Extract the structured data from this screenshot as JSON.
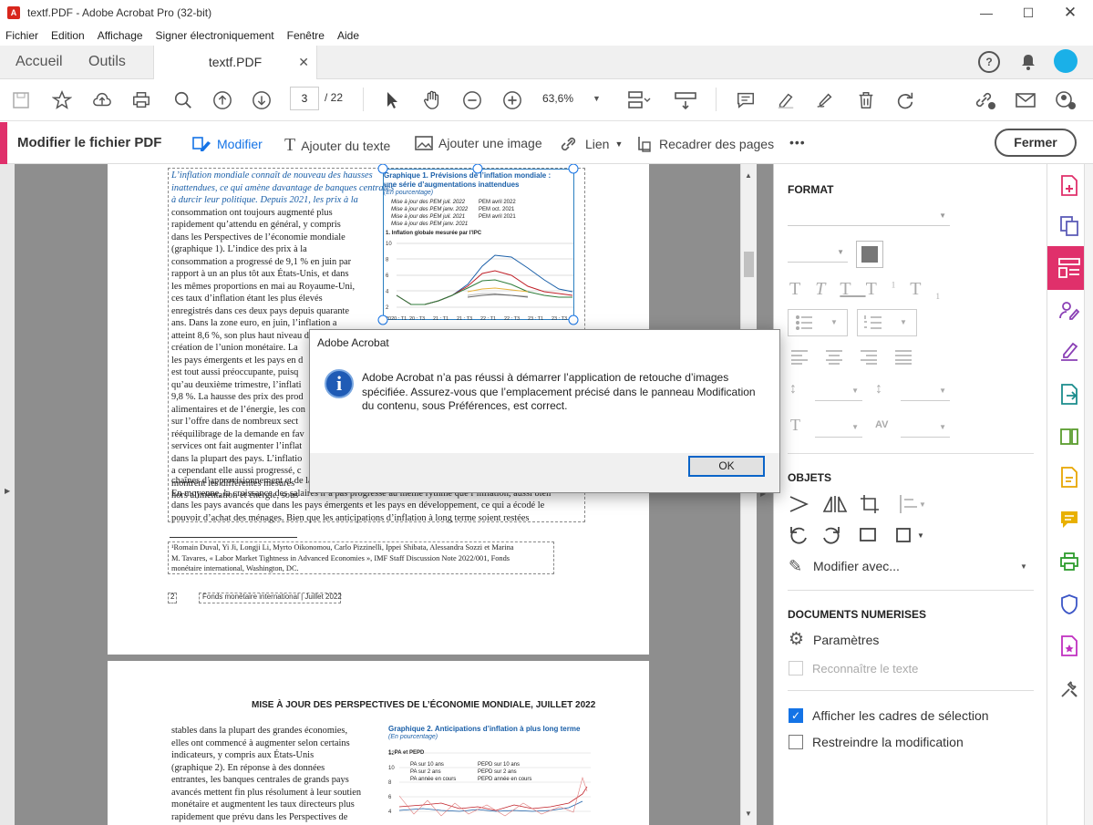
{
  "window": {
    "title": "textf.PDF - Adobe Acrobat Pro (32-bit)"
  },
  "menu": [
    "Fichier",
    "Edition",
    "Affichage",
    "Signer électroniquement",
    "Fenêtre",
    "Aide"
  ],
  "tabs": {
    "home": "Accueil",
    "tools": "Outils",
    "doc": "textf.PDF"
  },
  "toolbar": {
    "page_current": "3",
    "page_total": "/ 22",
    "zoom": "63,6%"
  },
  "editbar": {
    "title": "Modifier le fichier PDF",
    "items": [
      "Modifier",
      "Ajouter du texte",
      "Ajouter une image",
      "Lien",
      "Recadrer des pages"
    ],
    "more": "•••",
    "close": "Fermer"
  },
  "page1": {
    "col_lines": [
      "L’inflation mondiale connaît de nouveau des hausses",
      "inattendues, ce qui amène davantage de banques centrales",
      "à durcir leur politique. Depuis 2021, les prix à la",
      "consommation ont toujours augmenté plus",
      "rapidement qu’attendu en général, y compris",
      "dans les Perspectives de l’économie mondiale",
      "(graphique 1). L’indice des prix à la",
      "consommation a progressé de 9,1 % en juin par",
      "rapport à un an plus tôt aux États-Unis, et dans",
      "les mêmes proportions en mai au Royaume-Uni,",
      "ces taux d’inflation étant les plus élevés",
      "enregistrés dans ces deux pays depuis quarante",
      "ans. Dans la zone euro, en juin, l’inflation a",
      "atteint 8,6 %, son plus haut niveau depuis la",
      "création de l’union monétaire. La",
      "les pays émergents et les pays en d",
      "est tout aussi préoccupante, puisq",
      "qu’au deuxième trimestre, l’inflati",
      "9,8 %. La hausse des prix des prod",
      "alimentaires et de l’énergie, les con",
      "sur l’offre dans de nombreux sect",
      "rééquilibrage de la demande en fav",
      "services ont fait augmenter l’inflat",
      "dans la plupart des pays. L’inflatio",
      "a cependant elle aussi progressé, c",
      "montrent les différentes mesures",
      "hors alimentation et énergie, sous"
    ],
    "wide_lines": [
      "chaînes d’approvisionnement et de la pénurie de main-d’œuvre, en particulier dans les pays avancés¹.",
      "En moyenne, la croissance des salaires n’a pas progressé au même rythme que l’inflation, aussi bien",
      "dans les pays avancés que dans les pays émergents et les pays en développement, ce qui a écodé le",
      "pouvoir d’achat des ménages. Bien que les anticipations d’inflation à long terme soient restées"
    ],
    "footnote": [
      "¹Romain Duval, Yi Ji, Longji Li, Myrto Oikonomou, Carlo Pizzinelli, Ippei Shibata, Alessandra Sozzi et Marina",
      "M. Tavares, « Labor Market Tightness in Advanced Economies », IMF Staff Discussion Note 2022/001, Fonds",
      "monétaire international, Washington, DC."
    ],
    "page_num": "2",
    "page_footer": "Fonds monétaire international | Juillet 2022",
    "chart": {
      "title1": "Graphique 1.  Prévisions de l’inflation mondiale :",
      "title2": "une série d’augmentations inattendues",
      "unit": "(En pourcentage)",
      "legend_left": [
        "Mise à jour des PEM juil. 2022",
        "Mise à jour des PEM janv. 2022",
        "Mise à jour des PEM juil. 2021",
        "Mise à jour des PEM janv. 2021"
      ],
      "legend_right": [
        "PEM avril 2022",
        "PEM oct. 2021",
        "PEM avril 2021"
      ],
      "subtitle": "1.  Inflation globale mesurée par l’IPC",
      "yticks": [
        "10",
        "8",
        "6",
        "4",
        "2",
        "0"
      ],
      "xticks": [
        "2020 : T1",
        "20 : T3",
        "21 : T1",
        "21 : T3",
        "22 : T1",
        "22 : T3",
        "23 : T1",
        "23 : T3"
      ]
    }
  },
  "page2": {
    "header": "MISE À JOUR DES PERSPECTIVES DE L’ÉCONOMIE MONDIALE, JUILLET 2022",
    "lines": [
      "stables dans la plupart des grandes économies,",
      "elles ont commencé à augmenter selon certains",
      "indicateurs, y compris aux États-Unis",
      "(graphique 2). En réponse à des données",
      "entrantes, les banques centrales de grands pays",
      "avancés mettent fin plus résolument à leur soutien",
      "monétaire et augmentent les taux directeurs plus",
      "rapidement que prévu dans les Perspectives de"
    ],
    "chart": {
      "title": "Graphique 2.  Anticipations d’inflation à plus long terme",
      "unit": "(En pourcentage)",
      "subtitle": "1.  PA et PEPD",
      "yticks": [
        "12",
        "10",
        "8",
        "6",
        "4"
      ],
      "legend_left": [
        "PA sur 10 ans",
        "PA sur 2 ans",
        "PA année en cours"
      ],
      "legend_right": [
        "PEPD sur 10 ans",
        "PEPD sur 2 ans",
        "PEPD année en cours"
      ]
    }
  },
  "dialog": {
    "title": "Adobe Acrobat",
    "message": [
      "Adobe Acrobat n’a pas réussi à démarrer l’application de retouche d’images",
      "spécifiée. Assurez-vous que l’emplacement précisé dans le panneau Modification",
      "du contenu, sous Préférences, est correct."
    ],
    "ok": "OK"
  },
  "panel": {
    "format": "FORMAT",
    "objets": "OBJETS",
    "modify_with": "Modifier avec...",
    "docs": "DOCUMENTS NUMERISES",
    "params": "Paramètres",
    "recognize": "Reconnaître le texte",
    "show_boxes": "Afficher les cadres de sélection",
    "restrict": "Restreindre la modification"
  },
  "colors": {
    "accent": "#1473e6",
    "edit_tool": "#e0306b",
    "avatar": "#1ab0e8"
  }
}
